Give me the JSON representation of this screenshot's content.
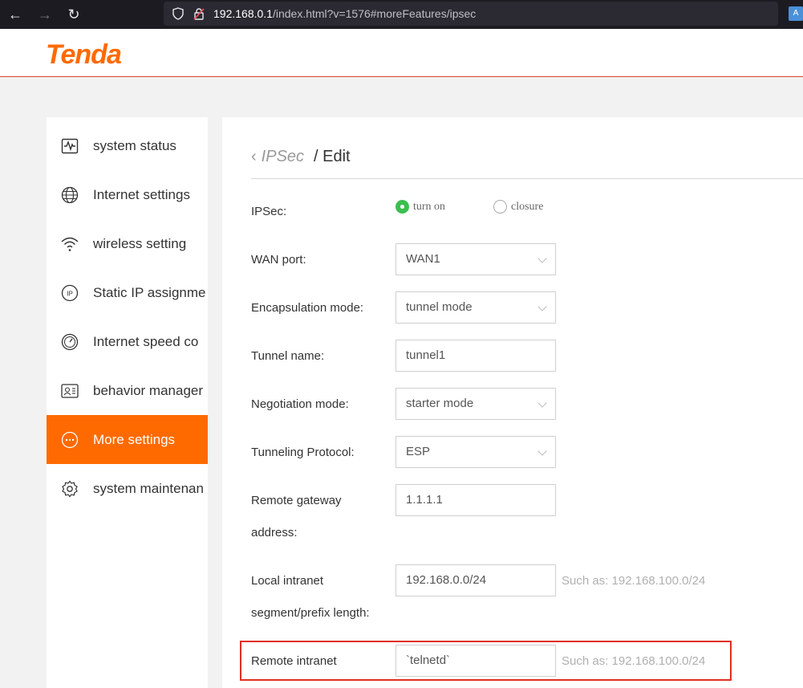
{
  "browser": {
    "url_host": "192.168.0.1",
    "url_path": "/index.html?v=1576#moreFeatures/ipsec"
  },
  "header": {
    "logo": "Tenda"
  },
  "sidebar": {
    "items": [
      {
        "label": "system status",
        "icon": "pulse-monitor-icon"
      },
      {
        "label": "Internet settings",
        "icon": "globe-icon"
      },
      {
        "label": "wireless setting",
        "icon": "wifi-icon"
      },
      {
        "label": "Static IP assignme",
        "icon": "ip-icon"
      },
      {
        "label": "Internet speed co",
        "icon": "speedometer-icon"
      },
      {
        "label": "behavior manager",
        "icon": "id-card-icon"
      },
      {
        "label": "More settings",
        "icon": "more-dots-icon",
        "active": true
      },
      {
        "label": "system maintenan",
        "icon": "gear-icon"
      }
    ]
  },
  "breadcrumb": {
    "back_label": "IPSec",
    "current": "/ Edit"
  },
  "form": {
    "ipsec_label": "IPSec:",
    "ipsec_on": "turn on",
    "ipsec_off": "closure",
    "wan_label": "WAN port:",
    "wan_value": "WAN1",
    "encap_label": "Encapsulation mode:",
    "encap_value": "tunnel mode",
    "tunnel_name_label": "Tunnel name:",
    "tunnel_name_value": "tunnel1",
    "negotiation_label": "Negotiation mode:",
    "negotiation_value": "starter mode",
    "protocol_label": "Tunneling Protocol:",
    "protocol_value": "ESP",
    "remote_gw_label_1": "Remote gateway",
    "remote_gw_label_2": "address:",
    "remote_gw_value": "1.1.1.1",
    "local_net_label_1": "Local intranet",
    "local_net_label_2": "segment/prefix length:",
    "local_net_value": "192.168.0.0/24",
    "local_net_hint": "Such as: 192.168.100.0/24",
    "remote_net_label": "Remote intranet",
    "remote_net_value": "`telnetd`",
    "remote_net_hint": "Such as: 192.168.100.0/24"
  },
  "colors": {
    "accent": "#ff6a00",
    "radio_on": "#3bbf4f",
    "highlight": "#e0301e"
  }
}
